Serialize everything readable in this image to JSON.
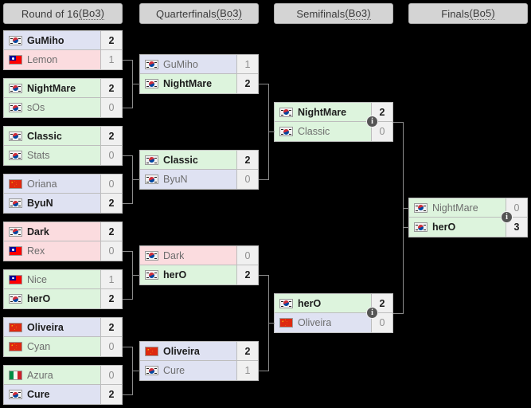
{
  "rounds": [
    {
      "id": "r16",
      "label_main": "Round of 16 ",
      "label_abbr": "(Bo3)"
    },
    {
      "id": "qf",
      "label_main": "Quarterfinals ",
      "label_abbr": "(Bo3)"
    },
    {
      "id": "sf",
      "label_main": "Semifinals ",
      "label_abbr": "(Bo3)"
    },
    {
      "id": "f",
      "label_main": "Finals ",
      "label_abbr": "(Bo5)"
    }
  ],
  "info_icon": "i",
  "colors": {
    "page_background": "#000000",
    "header_fill": "#d4d4d4",
    "header_border": "#b0b0b0",
    "match_border": "#bdbdbd",
    "score_fill": "#f0f0f0",
    "green": "#ddf4dd",
    "blue": "#dfe2f2",
    "pink": "#fbdcdf",
    "connector": "#8c8c8c",
    "info_badge": "#555555",
    "text_winner": "#1c1c1c",
    "text_loser": "#6d6d6d"
  },
  "matches": [
    {
      "id": "r16-m1",
      "round": "r16",
      "top": {
        "name": "GuMiho",
        "flag": "kr",
        "score": "2",
        "winner": true,
        "shade": "blue"
      },
      "bottom": {
        "name": "Lemon",
        "flag": "tw",
        "score": "1",
        "winner": false,
        "shade": "pink"
      }
    },
    {
      "id": "r16-m2",
      "round": "r16",
      "top": {
        "name": "NightMare",
        "flag": "kr",
        "score": "2",
        "winner": true,
        "shade": "green"
      },
      "bottom": {
        "name": "sOs",
        "flag": "kr",
        "score": "0",
        "winner": false,
        "shade": "green"
      }
    },
    {
      "id": "r16-m3",
      "round": "r16",
      "top": {
        "name": "Classic",
        "flag": "kr",
        "score": "2",
        "winner": true,
        "shade": "green"
      },
      "bottom": {
        "name": "Stats",
        "flag": "kr",
        "score": "0",
        "winner": false,
        "shade": "green"
      }
    },
    {
      "id": "r16-m4",
      "round": "r16",
      "top": {
        "name": "Oriana",
        "flag": "cn",
        "score": "0",
        "winner": false,
        "shade": "blue"
      },
      "bottom": {
        "name": "ByuN",
        "flag": "kr",
        "score": "2",
        "winner": true,
        "shade": "blue"
      }
    },
    {
      "id": "r16-m5",
      "round": "r16",
      "top": {
        "name": "Dark",
        "flag": "kr",
        "score": "2",
        "winner": true,
        "shade": "pink"
      },
      "bottom": {
        "name": "Rex",
        "flag": "tw",
        "score": "0",
        "winner": false,
        "shade": "pink"
      }
    },
    {
      "id": "r16-m6",
      "round": "r16",
      "top": {
        "name": "Nice",
        "flag": "tw",
        "score": "1",
        "winner": false,
        "shade": "green"
      },
      "bottom": {
        "name": "herO",
        "flag": "kr",
        "score": "2",
        "winner": true,
        "shade": "green"
      }
    },
    {
      "id": "r16-m7",
      "round": "r16",
      "top": {
        "name": "Oliveira",
        "flag": "cn",
        "score": "2",
        "winner": true,
        "shade": "blue"
      },
      "bottom": {
        "name": "Cyan",
        "flag": "cn",
        "score": "0",
        "winner": false,
        "shade": "green"
      }
    },
    {
      "id": "r16-m8",
      "round": "r16",
      "top": {
        "name": "Azura",
        "flag": "it",
        "score": "0",
        "winner": false,
        "shade": "green"
      },
      "bottom": {
        "name": "Cure",
        "flag": "kr",
        "score": "2",
        "winner": true,
        "shade": "blue"
      }
    },
    {
      "id": "qf-m1",
      "round": "qf",
      "top": {
        "name": "GuMiho",
        "flag": "kr",
        "score": "1",
        "winner": false,
        "shade": "blue"
      },
      "bottom": {
        "name": "NightMare",
        "flag": "kr",
        "score": "2",
        "winner": true,
        "shade": "green"
      }
    },
    {
      "id": "qf-m2",
      "round": "qf",
      "top": {
        "name": "Classic",
        "flag": "kr",
        "score": "2",
        "winner": true,
        "shade": "green"
      },
      "bottom": {
        "name": "ByuN",
        "flag": "kr",
        "score": "0",
        "winner": false,
        "shade": "blue"
      }
    },
    {
      "id": "qf-m3",
      "round": "qf",
      "top": {
        "name": "Dark",
        "flag": "kr",
        "score": "0",
        "winner": false,
        "shade": "pink"
      },
      "bottom": {
        "name": "herO",
        "flag": "kr",
        "score": "2",
        "winner": true,
        "shade": "green"
      }
    },
    {
      "id": "qf-m4",
      "round": "qf",
      "top": {
        "name": "Oliveira",
        "flag": "cn",
        "score": "2",
        "winner": true,
        "shade": "blue"
      },
      "bottom": {
        "name": "Cure",
        "flag": "kr",
        "score": "1",
        "winner": false,
        "shade": "blue"
      }
    },
    {
      "id": "sf-m1",
      "round": "sf",
      "has_info": true,
      "top": {
        "name": "NightMare",
        "flag": "kr",
        "score": "2",
        "winner": true,
        "shade": "green"
      },
      "bottom": {
        "name": "Classic",
        "flag": "kr",
        "score": "0",
        "winner": false,
        "shade": "green"
      }
    },
    {
      "id": "sf-m2",
      "round": "sf",
      "has_info": true,
      "top": {
        "name": "herO",
        "flag": "kr",
        "score": "2",
        "winner": true,
        "shade": "green"
      },
      "bottom": {
        "name": "Oliveira",
        "flag": "cn",
        "score": "0",
        "winner": false,
        "shade": "blue"
      }
    },
    {
      "id": "f-m1",
      "round": "f",
      "has_info": true,
      "top": {
        "name": "NightMare",
        "flag": "kr",
        "score": "0",
        "winner": false,
        "shade": "green"
      },
      "bottom": {
        "name": "herO",
        "flag": "kr",
        "score": "3",
        "winner": true,
        "shade": "green"
      }
    }
  ]
}
